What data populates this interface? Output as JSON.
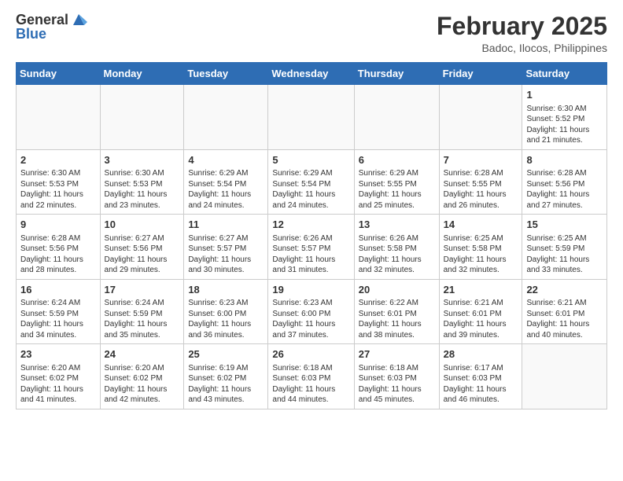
{
  "header": {
    "logo": {
      "general": "General",
      "blue": "Blue"
    },
    "title": "February 2025",
    "location": "Badoc, Ilocos, Philippines"
  },
  "weekdays": [
    "Sunday",
    "Monday",
    "Tuesday",
    "Wednesday",
    "Thursday",
    "Friday",
    "Saturday"
  ],
  "weeks": [
    [
      null,
      null,
      null,
      null,
      null,
      null,
      {
        "day": 1,
        "sunrise": "Sunrise: 6:30 AM",
        "sunset": "Sunset: 5:52 PM",
        "daylight": "Daylight: 11 hours and 21 minutes."
      }
    ],
    [
      {
        "day": 2,
        "sunrise": "Sunrise: 6:30 AM",
        "sunset": "Sunset: 5:53 PM",
        "daylight": "Daylight: 11 hours and 22 minutes."
      },
      {
        "day": 3,
        "sunrise": "Sunrise: 6:30 AM",
        "sunset": "Sunset: 5:53 PM",
        "daylight": "Daylight: 11 hours and 23 minutes."
      },
      {
        "day": 4,
        "sunrise": "Sunrise: 6:29 AM",
        "sunset": "Sunset: 5:54 PM",
        "daylight": "Daylight: 11 hours and 24 minutes."
      },
      {
        "day": 5,
        "sunrise": "Sunrise: 6:29 AM",
        "sunset": "Sunset: 5:54 PM",
        "daylight": "Daylight: 11 hours and 24 minutes."
      },
      {
        "day": 6,
        "sunrise": "Sunrise: 6:29 AM",
        "sunset": "Sunset: 5:55 PM",
        "daylight": "Daylight: 11 hours and 25 minutes."
      },
      {
        "day": 7,
        "sunrise": "Sunrise: 6:28 AM",
        "sunset": "Sunset: 5:55 PM",
        "daylight": "Daylight: 11 hours and 26 minutes."
      },
      {
        "day": 8,
        "sunrise": "Sunrise: 6:28 AM",
        "sunset": "Sunset: 5:56 PM",
        "daylight": "Daylight: 11 hours and 27 minutes."
      }
    ],
    [
      {
        "day": 9,
        "sunrise": "Sunrise: 6:28 AM",
        "sunset": "Sunset: 5:56 PM",
        "daylight": "Daylight: 11 hours and 28 minutes."
      },
      {
        "day": 10,
        "sunrise": "Sunrise: 6:27 AM",
        "sunset": "Sunset: 5:56 PM",
        "daylight": "Daylight: 11 hours and 29 minutes."
      },
      {
        "day": 11,
        "sunrise": "Sunrise: 6:27 AM",
        "sunset": "Sunset: 5:57 PM",
        "daylight": "Daylight: 11 hours and 30 minutes."
      },
      {
        "day": 12,
        "sunrise": "Sunrise: 6:26 AM",
        "sunset": "Sunset: 5:57 PM",
        "daylight": "Daylight: 11 hours and 31 minutes."
      },
      {
        "day": 13,
        "sunrise": "Sunrise: 6:26 AM",
        "sunset": "Sunset: 5:58 PM",
        "daylight": "Daylight: 11 hours and 32 minutes."
      },
      {
        "day": 14,
        "sunrise": "Sunrise: 6:25 AM",
        "sunset": "Sunset: 5:58 PM",
        "daylight": "Daylight: 11 hours and 32 minutes."
      },
      {
        "day": 15,
        "sunrise": "Sunrise: 6:25 AM",
        "sunset": "Sunset: 5:59 PM",
        "daylight": "Daylight: 11 hours and 33 minutes."
      }
    ],
    [
      {
        "day": 16,
        "sunrise": "Sunrise: 6:24 AM",
        "sunset": "Sunset: 5:59 PM",
        "daylight": "Daylight: 11 hours and 34 minutes."
      },
      {
        "day": 17,
        "sunrise": "Sunrise: 6:24 AM",
        "sunset": "Sunset: 5:59 PM",
        "daylight": "Daylight: 11 hours and 35 minutes."
      },
      {
        "day": 18,
        "sunrise": "Sunrise: 6:23 AM",
        "sunset": "Sunset: 6:00 PM",
        "daylight": "Daylight: 11 hours and 36 minutes."
      },
      {
        "day": 19,
        "sunrise": "Sunrise: 6:23 AM",
        "sunset": "Sunset: 6:00 PM",
        "daylight": "Daylight: 11 hours and 37 minutes."
      },
      {
        "day": 20,
        "sunrise": "Sunrise: 6:22 AM",
        "sunset": "Sunset: 6:01 PM",
        "daylight": "Daylight: 11 hours and 38 minutes."
      },
      {
        "day": 21,
        "sunrise": "Sunrise: 6:21 AM",
        "sunset": "Sunset: 6:01 PM",
        "daylight": "Daylight: 11 hours and 39 minutes."
      },
      {
        "day": 22,
        "sunrise": "Sunrise: 6:21 AM",
        "sunset": "Sunset: 6:01 PM",
        "daylight": "Daylight: 11 hours and 40 minutes."
      }
    ],
    [
      {
        "day": 23,
        "sunrise": "Sunrise: 6:20 AM",
        "sunset": "Sunset: 6:02 PM",
        "daylight": "Daylight: 11 hours and 41 minutes."
      },
      {
        "day": 24,
        "sunrise": "Sunrise: 6:20 AM",
        "sunset": "Sunset: 6:02 PM",
        "daylight": "Daylight: 11 hours and 42 minutes."
      },
      {
        "day": 25,
        "sunrise": "Sunrise: 6:19 AM",
        "sunset": "Sunset: 6:02 PM",
        "daylight": "Daylight: 11 hours and 43 minutes."
      },
      {
        "day": 26,
        "sunrise": "Sunrise: 6:18 AM",
        "sunset": "Sunset: 6:03 PM",
        "daylight": "Daylight: 11 hours and 44 minutes."
      },
      {
        "day": 27,
        "sunrise": "Sunrise: 6:18 AM",
        "sunset": "Sunset: 6:03 PM",
        "daylight": "Daylight: 11 hours and 45 minutes."
      },
      {
        "day": 28,
        "sunrise": "Sunrise: 6:17 AM",
        "sunset": "Sunset: 6:03 PM",
        "daylight": "Daylight: 11 hours and 46 minutes."
      },
      null
    ]
  ]
}
